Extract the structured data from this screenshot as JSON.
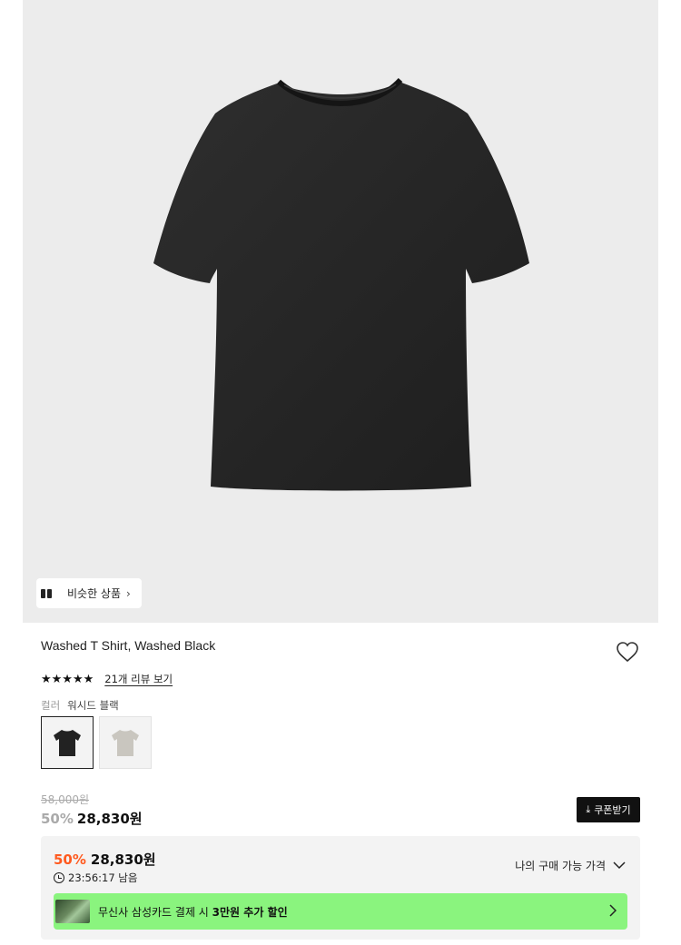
{
  "similar": {
    "label": "비슷한 상품"
  },
  "product": {
    "title": "Washed T Shirt, Washed Black"
  },
  "rating": {
    "stars": "★★★★★",
    "review_link": "21개 리뷰 보기"
  },
  "color": {
    "label": "컬러",
    "value": "워시드 블랙"
  },
  "swatches": [
    {
      "color": "#222222",
      "selected": true
    },
    {
      "color": "#c9c6bf",
      "selected": false
    }
  ],
  "price": {
    "original": "58,000원",
    "discount": "50%",
    "sale": "28,830원",
    "coupon_label": "쿠폰받기"
  },
  "buy_box": {
    "discount": "50%",
    "price": "28,830원",
    "timer": "23:56:17 남음",
    "my_price_label": "나의 구매 가능 가격"
  },
  "promo": {
    "text_prefix": "무신사 삼성카드 결제 시 ",
    "text_bold": "3만원 추가 할인"
  },
  "colors": {
    "accent_orange": "#ff5a1f",
    "promo_green": "#8af47e",
    "hero_bg": "#ececec"
  }
}
